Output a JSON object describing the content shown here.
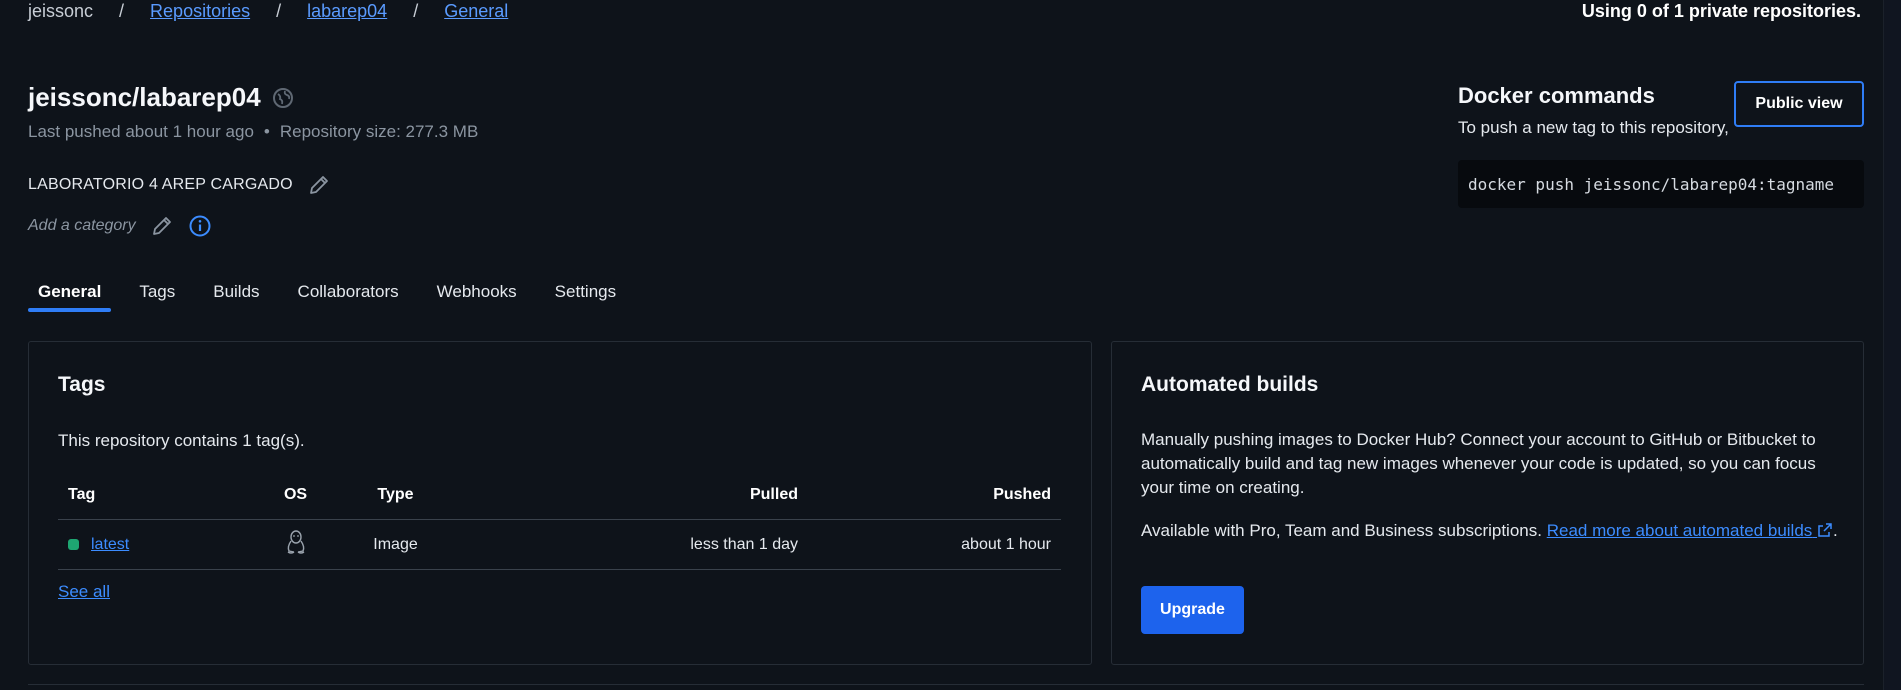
{
  "breadcrumb": {
    "user": "jeissonc",
    "separator": "/",
    "repositories": "Repositories",
    "repo": "labarep04",
    "current": "General"
  },
  "usage_text": "Using 0 of 1 private repositories.",
  "repo": {
    "title": "jeissonc/labarep04",
    "last_pushed": "Last pushed about 1 hour ago",
    "dot": "•",
    "size": "Repository size: 277.3 MB",
    "description": "LABORATORIO 4 AREP CARGADO",
    "category_placeholder": "Add a category"
  },
  "tabs": [
    {
      "label": "General",
      "active": true
    },
    {
      "label": "Tags",
      "active": false
    },
    {
      "label": "Builds",
      "active": false
    },
    {
      "label": "Collaborators",
      "active": false
    },
    {
      "label": "Webhooks",
      "active": false
    },
    {
      "label": "Settings",
      "active": false
    }
  ],
  "docker": {
    "title": "Docker commands",
    "subtitle": "To push a new tag to this repository,",
    "command": "docker push jeissonc/labarep04:tagname",
    "public_view_label": "Public view"
  },
  "tags_card": {
    "title": "Tags",
    "count_text": "This repository contains 1 tag(s).",
    "headers": {
      "tag": "Tag",
      "os": "OS",
      "type": "Type",
      "pulled": "Pulled",
      "pushed": "Pushed"
    },
    "rows": [
      {
        "tag": "latest",
        "os_icon": "linux-tux-icon",
        "type": "Image",
        "pulled": "less than 1 day",
        "pushed": "about 1 hour"
      }
    ],
    "see_all": "See all"
  },
  "builds_card": {
    "title": "Automated builds",
    "text": "Manually pushing images to Docker Hub? Connect your account to GitHub or Bitbucket to automatically build and tag new images whenever your code is updated, so you can focus your time on creating.",
    "availability": "Available with Pro, Team and Business subscriptions.",
    "link_text": "Read more about automated builds",
    "period": ".",
    "upgrade_label": "Upgrade"
  },
  "colors": {
    "background": "#0e131a",
    "accent": "#2f7df6",
    "link": "#3c8cff",
    "status_green": "#1ea672",
    "upgrade_button": "#1d63ed"
  }
}
